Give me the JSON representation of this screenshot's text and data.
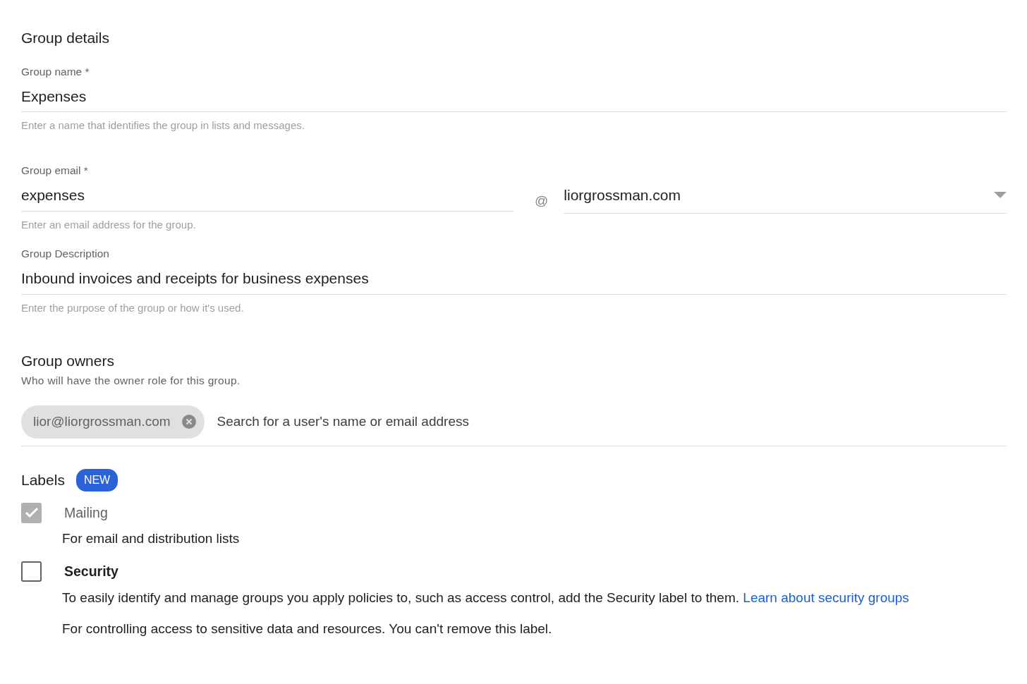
{
  "section_title": "Group details",
  "name_field": {
    "label": "Group name *",
    "value": "Expenses",
    "hint": "Enter a name that identifies the group in lists and messages."
  },
  "email_field": {
    "label": "Group email *",
    "value": "expenses",
    "at": "@",
    "domain": "liorgrossman.com",
    "hint": "Enter an email address for the group."
  },
  "description_field": {
    "label": "Group Description",
    "value": "Inbound invoices and receipts for business expenses",
    "hint": "Enter the purpose of the group or how it's used."
  },
  "owners": {
    "title": "Group owners",
    "subtitle": "Who will have the owner role for this group.",
    "chips": [
      "lior@liorgrossman.com"
    ],
    "placeholder": "Search for a user's name or email address"
  },
  "labels": {
    "title": "Labels",
    "badge": "NEW",
    "items": [
      {
        "name": "Mailing",
        "checked": true,
        "disabled": true,
        "description": "For email and distribution lists"
      },
      {
        "name": "Security",
        "checked": false,
        "disabled": false,
        "info": "To easily identify and manage groups you apply policies to, such as access control, add the Security label to them.",
        "link": "Learn about security groups",
        "description": "For controlling access to sensitive data and resources. You can't remove this label."
      }
    ]
  }
}
